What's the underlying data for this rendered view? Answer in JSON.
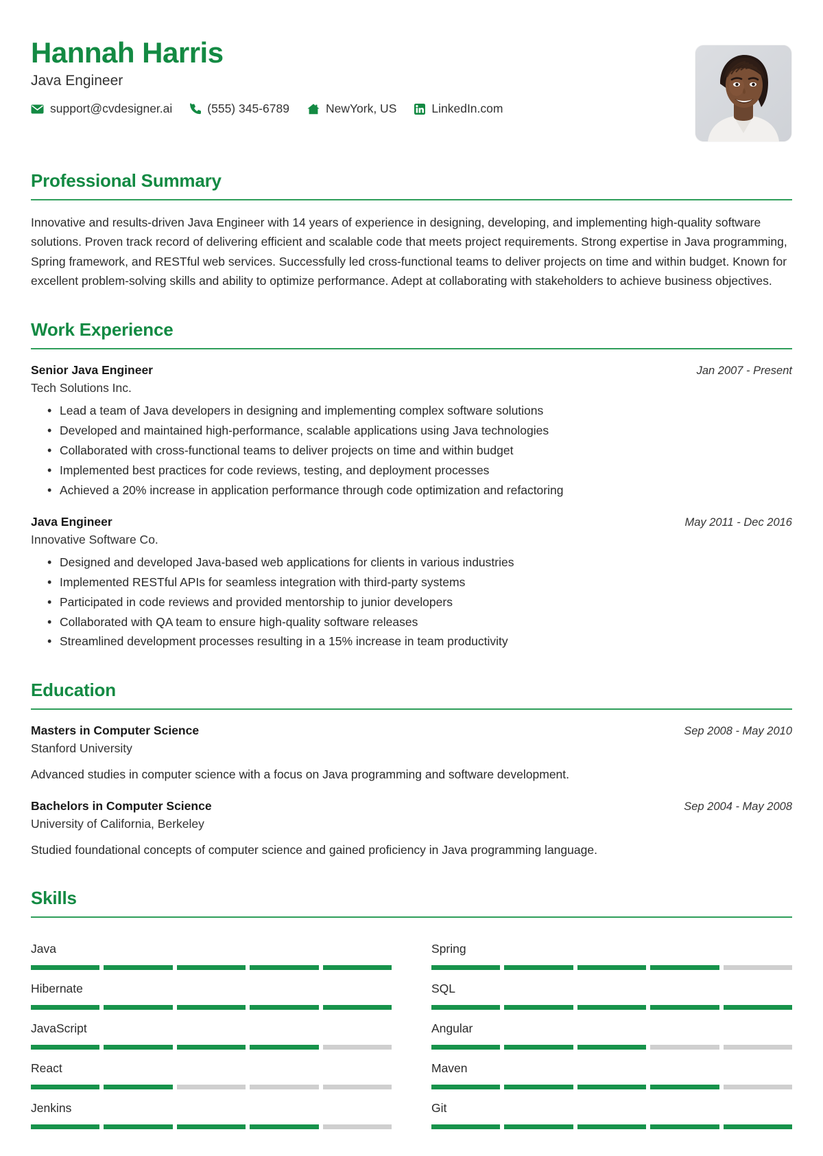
{
  "theme": {
    "accent": "#138a43",
    "rule": "#2f9e5a",
    "seg_on": "#17934b",
    "seg_off": "#cfcfcf"
  },
  "header": {
    "name": "Hannah Harris",
    "job_title": "Java Engineer",
    "contacts": [
      {
        "icon": "envelope-icon",
        "name": "contact-email",
        "value": "support@cvdesigner.ai"
      },
      {
        "icon": "phone-icon",
        "name": "contact-phone",
        "value": "(555) 345-6789"
      },
      {
        "icon": "home-icon",
        "name": "contact-location",
        "value": "NewYork, US"
      },
      {
        "icon": "linkedin-icon",
        "name": "contact-linkedin",
        "value": "LinkedIn.com"
      }
    ]
  },
  "summary": {
    "heading": "Professional Summary",
    "text": "Innovative and results-driven Java Engineer with 14 years of experience in designing, developing, and implementing high-quality software solutions. Proven track record of delivering efficient and scalable code that meets project requirements. Strong expertise in Java programming, Spring framework, and RESTful web services. Successfully led cross-functional teams to deliver projects on time and within budget. Known for excellent problem-solving skills and ability to optimize performance. Adept at collaborating with stakeholders to achieve business objectives."
  },
  "experience": {
    "heading": "Work Experience",
    "entries": [
      {
        "role": "Senior Java Engineer",
        "org": "Tech Solutions Inc.",
        "date": "Jan 2007 - Present",
        "bullets": [
          "Lead a team of Java developers in designing and implementing complex software solutions",
          "Developed and maintained high-performance, scalable applications using Java technologies",
          "Collaborated with cross-functional teams to deliver projects on time and within budget",
          "Implemented best practices for code reviews, testing, and deployment processes",
          "Achieved a 20% increase in application performance through code optimization and refactoring"
        ]
      },
      {
        "role": "Java Engineer",
        "org": "Innovative Software Co.",
        "date": "May 2011 - Dec 2016",
        "bullets": [
          "Designed and developed Java-based web applications for clients in various industries",
          "Implemented RESTful APIs for seamless integration with third-party systems",
          "Participated in code reviews and provided mentorship to junior developers",
          "Collaborated with QA team to ensure high-quality software releases",
          "Streamlined development processes resulting in a 15% increase in team productivity"
        ]
      }
    ]
  },
  "education": {
    "heading": "Education",
    "entries": [
      {
        "degree": "Masters in Computer Science",
        "school": "Stanford University",
        "date": "Sep 2008 - May 2010",
        "description": "Advanced studies in computer science with a focus on Java programming and software development."
      },
      {
        "degree": "Bachelors in Computer Science",
        "school": "University of California, Berkeley",
        "date": "Sep 2004 - May 2008",
        "description": "Studied foundational concepts of computer science and gained proficiency in Java programming language."
      }
    ]
  },
  "skills": {
    "heading": "Skills",
    "max_level": 5,
    "items": [
      {
        "name": "Java",
        "level": 5
      },
      {
        "name": "Spring",
        "level": 4
      },
      {
        "name": "Hibernate",
        "level": 5
      },
      {
        "name": "SQL",
        "level": 5
      },
      {
        "name": "JavaScript",
        "level": 4
      },
      {
        "name": "Angular",
        "level": 3
      },
      {
        "name": "React",
        "level": 2
      },
      {
        "name": "Maven",
        "level": 4
      },
      {
        "name": "Jenkins",
        "level": 4
      },
      {
        "name": "Git",
        "level": 5
      }
    ]
  }
}
